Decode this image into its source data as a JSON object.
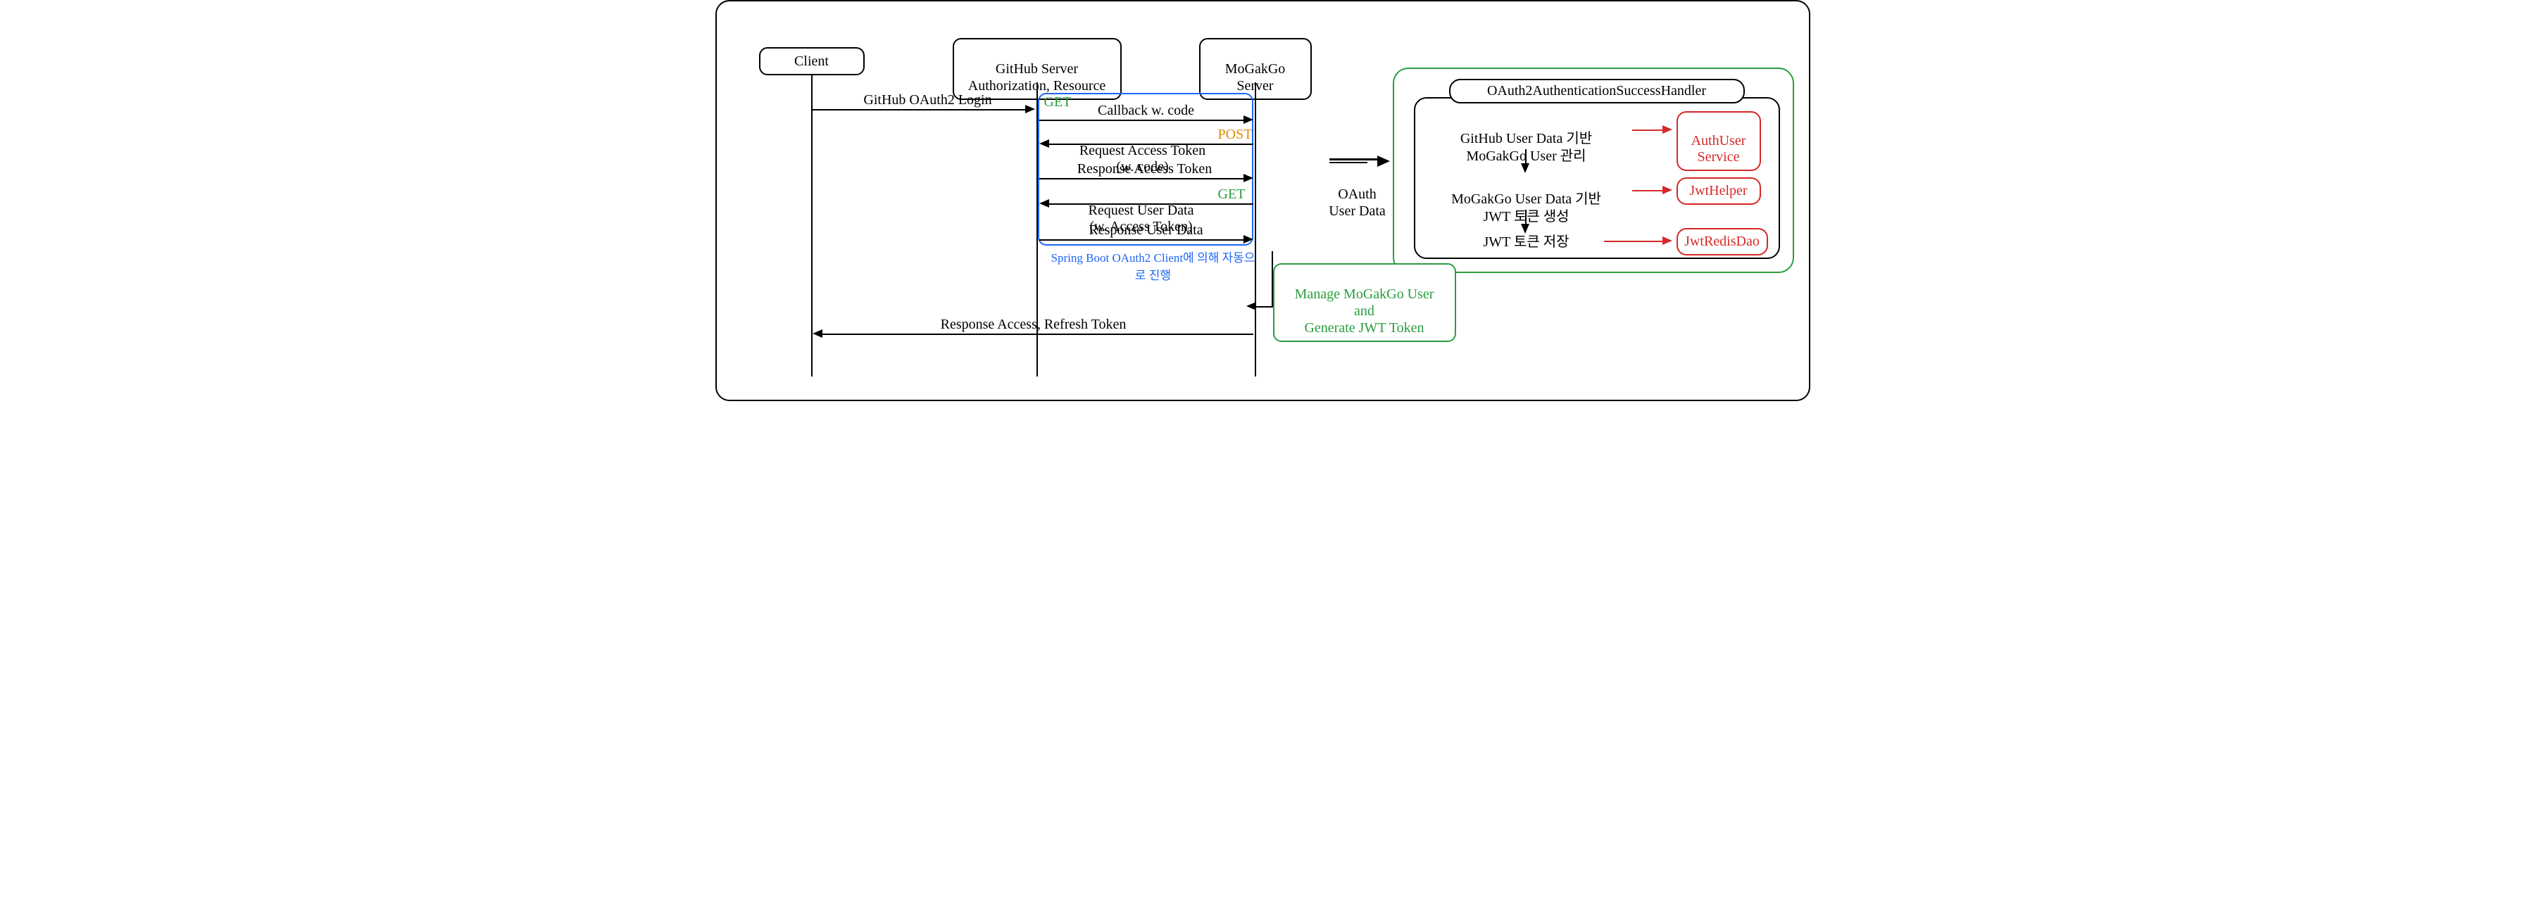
{
  "actors": {
    "client": "Client",
    "github": "GitHub Server\nAuthorization, Resource",
    "mogakgo": "MoGakGo\nServer"
  },
  "messages": {
    "login": "GitHub OAuth2 Login",
    "callback": "Callback w. code",
    "req_token": "Request Access Token\n(w. code)",
    "res_token": "Response Access Token",
    "req_user": "Request User Data\n(w. Access Token)",
    "res_user": "Response User Data",
    "response_final": "Response Access, Refresh Token"
  },
  "methods": {
    "get": "GET",
    "post": "POST"
  },
  "blue_caption": "Spring Boot OAuth2 Client에 의해 자동으로 진행",
  "oauth_label": "OAuth\nUser Data",
  "handler_title": "OAuth2AuthenticationSuccessHandler",
  "steps": {
    "s1": "GitHub User Data 기반\nMoGakGo User 관리",
    "s2": "MoGakGo User Data 기반\nJWT 토큰 생성",
    "s3": "JWT 토큰 저장"
  },
  "services": {
    "auth_user": "AuthUser\nService",
    "jwt_helper": "JwtHelper",
    "jwt_redis": "JwtRedisDao"
  },
  "green_note": "Manage MoGakGo User and\nGenerate JWT Token"
}
